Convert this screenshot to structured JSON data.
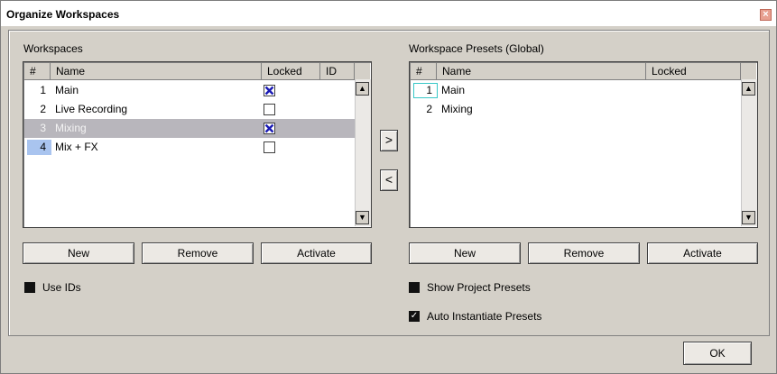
{
  "window": {
    "title": "Organize Workspaces",
    "close": "×"
  },
  "left": {
    "label": "Workspaces",
    "columns": {
      "num": "#",
      "name": "Name",
      "locked": "Locked",
      "id": "ID"
    },
    "rows": [
      {
        "num": "1",
        "name": "Main",
        "locked": true
      },
      {
        "num": "2",
        "name": "Live Recording",
        "locked": false
      },
      {
        "num": "3",
        "name": "Mixing",
        "locked": true
      },
      {
        "num": "4",
        "name": "Mix + FX",
        "locked": false
      }
    ],
    "buttons": {
      "new": "New",
      "remove": "Remove",
      "activate": "Activate"
    },
    "use_ids": "Use IDs"
  },
  "right": {
    "label": "Workspace Presets (Global)",
    "columns": {
      "num": "#",
      "name": "Name",
      "locked": "Locked"
    },
    "rows": [
      {
        "num": "1",
        "name": "Main"
      },
      {
        "num": "2",
        "name": "Mixing"
      }
    ],
    "buttons": {
      "new": "New",
      "remove": "Remove",
      "activate": "Activate"
    },
    "show_project_presets": "Show Project Presets",
    "auto_instantiate": "Auto Instantiate Presets"
  },
  "transfer": {
    "right": ">",
    "left": "<"
  },
  "scroll": {
    "up": "▲",
    "down": "▼"
  },
  "checkmark": "✓",
  "ok": "OK",
  "colors": {
    "selected_row": "#b8b6bc",
    "check_x": "#1a1ab4",
    "num_highlight": "#a9c4ef"
  }
}
